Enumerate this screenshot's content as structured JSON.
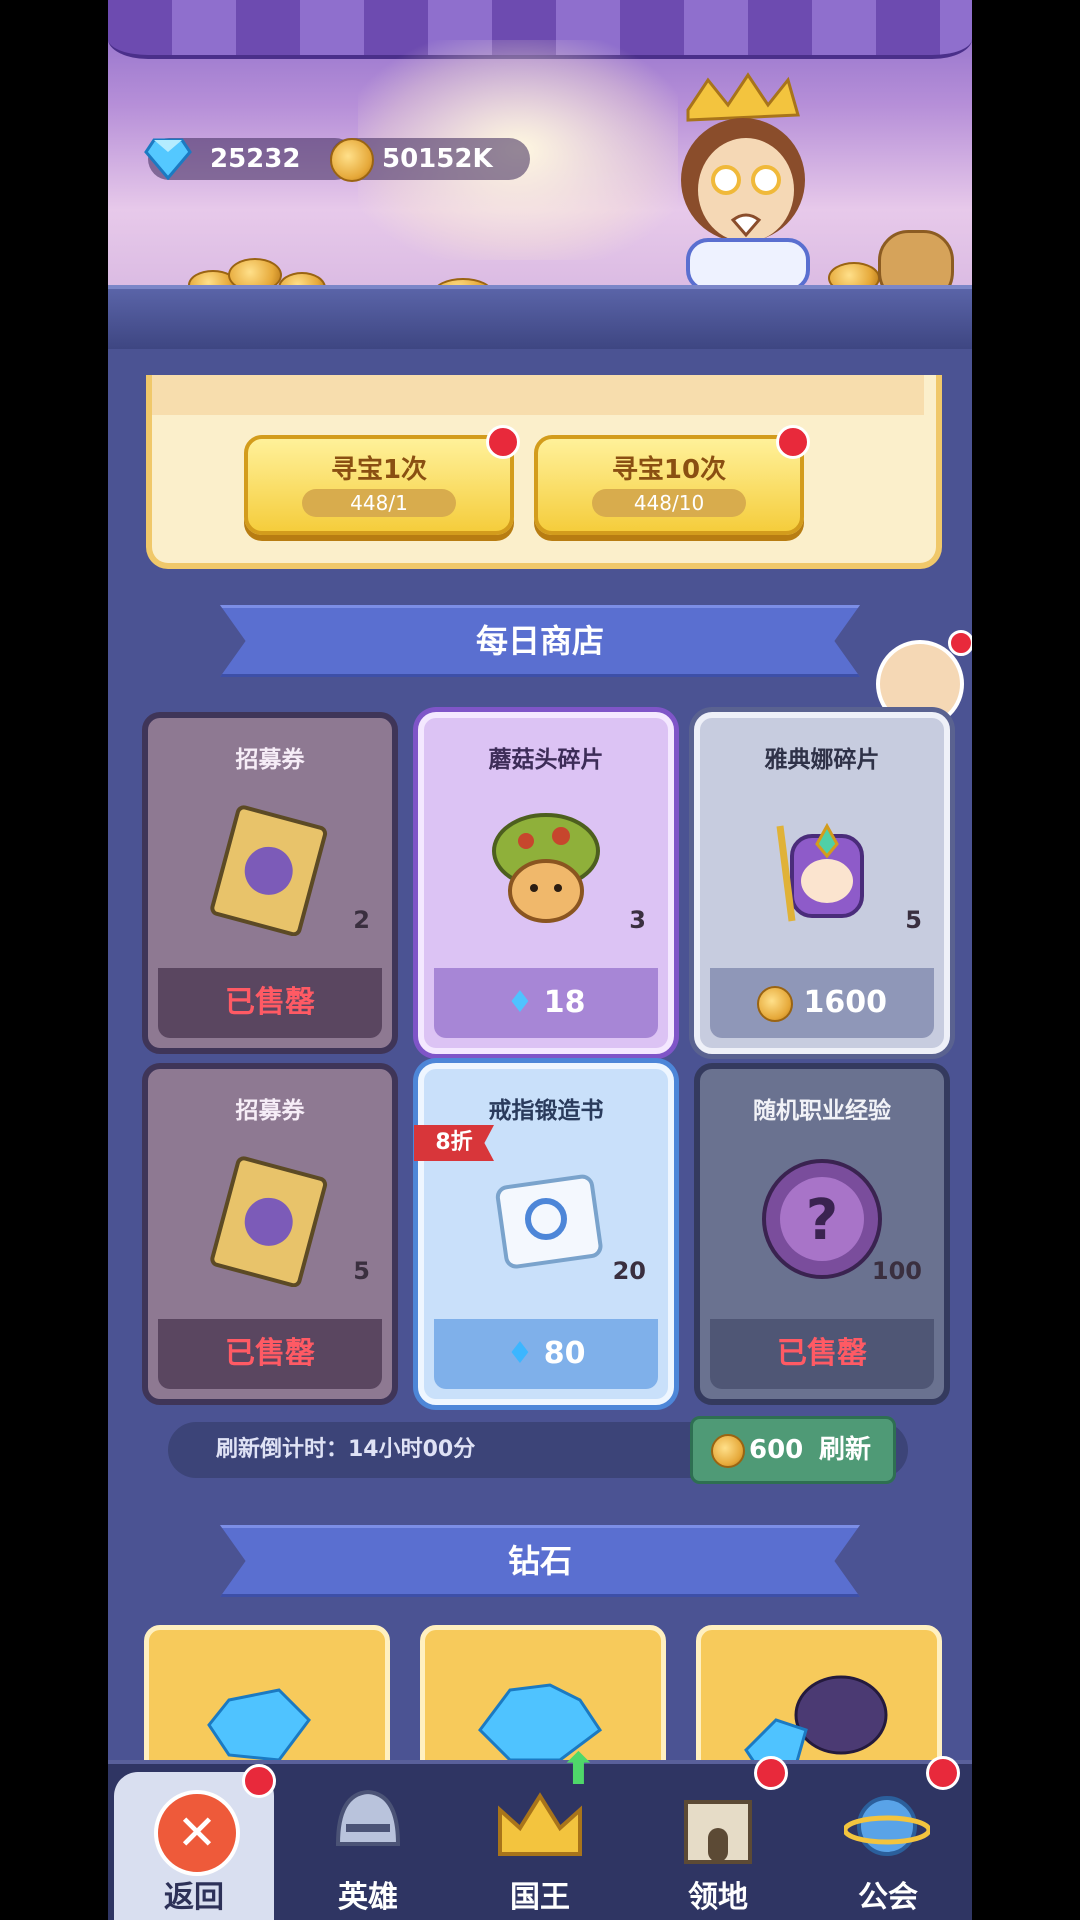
{
  "currency": {
    "gems": "25232",
    "coins": "50152K"
  },
  "treasure": {
    "buttons": [
      {
        "label": "寻宝1次",
        "cost": "448/1"
      },
      {
        "label": "寻宝10次",
        "cost": "448/10"
      }
    ]
  },
  "daily_shop": {
    "title": "每日商店",
    "items": [
      {
        "name": "招募券",
        "qty": "2",
        "price": "已售罄",
        "status": "sold"
      },
      {
        "name": "蘑菇头碎片",
        "qty": "3",
        "price": "18",
        "currency": "gem"
      },
      {
        "name": "雅典娜碎片",
        "qty": "5",
        "price": "1600",
        "currency": "coin"
      },
      {
        "name": "招募券",
        "qty": "5",
        "price": "已售罄",
        "status": "sold"
      },
      {
        "name": "戒指锻造书",
        "qty": "20",
        "price": "80",
        "currency": "gem",
        "badge": "8折"
      },
      {
        "name": "随机职业经验",
        "qty": "100",
        "price": "已售罄",
        "status": "sold"
      }
    ],
    "refresh_countdown": "刷新倒计时：14小时00分",
    "refresh_cost": "600",
    "refresh_label": "刷新"
  },
  "diamond_section": {
    "title": "钻石"
  },
  "nav": [
    {
      "label": "返回"
    },
    {
      "label": "英雄"
    },
    {
      "label": "国王"
    },
    {
      "label": "领地"
    },
    {
      "label": "公会"
    }
  ],
  "colors": {
    "accent_red": "#e8293b",
    "gem_blue": "#4fc3ff",
    "coin_gold": "#e6a93a"
  }
}
